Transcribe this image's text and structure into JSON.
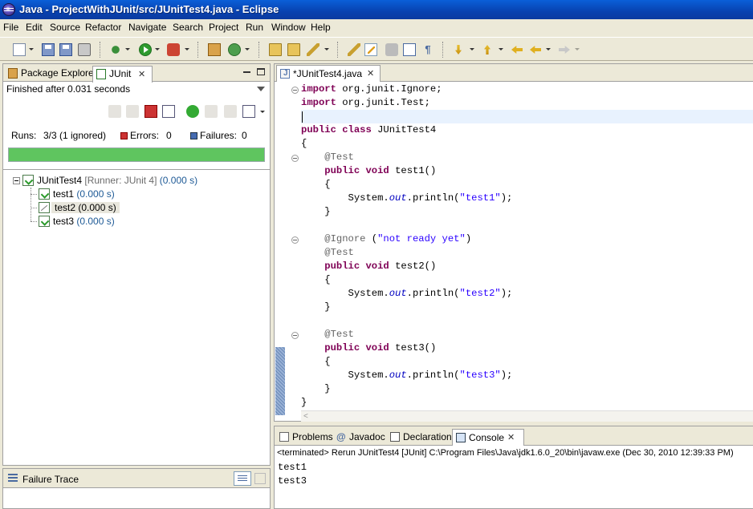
{
  "window": {
    "title": "Java - ProjectWithJUnit/src/JUnitTest4.java - Eclipse"
  },
  "menu": [
    "File",
    "Edit",
    "Source",
    "Refactor",
    "Navigate",
    "Search",
    "Project",
    "Run",
    "Window",
    "Help"
  ],
  "left_view": {
    "tabs": [
      "Package Explorer",
      "JUnit"
    ],
    "status": "Finished after 0.031 seconds",
    "runs_label": "Runs:",
    "runs_value": "3/3 (1 ignored)",
    "errors_label": "Errors:",
    "errors_value": "0",
    "failures_label": "Failures:",
    "failures_value": "0",
    "progress": 1.0,
    "progress_color": "#5fc55f",
    "tree": {
      "root": {
        "name": "JUnitTest4",
        "runner": "[Runner: JUnit 4]",
        "time": "(0.000 s)"
      },
      "tests": [
        {
          "name": "test1",
          "time": "(0.000 s)",
          "status": "passed"
        },
        {
          "name": "test2",
          "time": "(0.000 s)",
          "status": "ignored"
        },
        {
          "name": "test3",
          "time": "(0.000 s)",
          "status": "passed"
        }
      ]
    },
    "failure_trace_title": "Failure Trace"
  },
  "editor": {
    "tab_label": "*JUnitTest4.java",
    "lines": [
      [
        {
          "t": "import",
          "c": "kw"
        },
        {
          "t": " org.junit.Ignore;"
        }
      ],
      [
        {
          "t": "import",
          "c": "kw"
        },
        {
          "t": " org.junit.Test;"
        }
      ],
      [],
      [
        {
          "t": "public",
          "c": "kw"
        },
        {
          "t": " "
        },
        {
          "t": "class",
          "c": "kw"
        },
        {
          "t": " JUnitTest4"
        }
      ],
      [
        {
          "t": "{"
        }
      ],
      [
        {
          "t": "    "
        },
        {
          "t": "@Test",
          "c": "ann"
        }
      ],
      [
        {
          "t": "    "
        },
        {
          "t": "public",
          "c": "kw"
        },
        {
          "t": " "
        },
        {
          "t": "void",
          "c": "kw"
        },
        {
          "t": " test1()"
        }
      ],
      [
        {
          "t": "    {"
        }
      ],
      [
        {
          "t": "        System."
        },
        {
          "t": "out",
          "c": "it"
        },
        {
          "t": ".println("
        },
        {
          "t": "\"test1\"",
          "c": "str"
        },
        {
          "t": ");"
        }
      ],
      [
        {
          "t": "    }"
        }
      ],
      [],
      [
        {
          "t": "    "
        },
        {
          "t": "@Ignore",
          "c": "ann"
        },
        {
          "t": " ("
        },
        {
          "t": "\"not ready yet\"",
          "c": "str"
        },
        {
          "t": ")"
        }
      ],
      [
        {
          "t": "    "
        },
        {
          "t": "@Test",
          "c": "ann"
        }
      ],
      [
        {
          "t": "    "
        },
        {
          "t": "public",
          "c": "kw"
        },
        {
          "t": " "
        },
        {
          "t": "void",
          "c": "kw"
        },
        {
          "t": " test2()"
        }
      ],
      [
        {
          "t": "    {"
        }
      ],
      [
        {
          "t": "        System."
        },
        {
          "t": "out",
          "c": "it"
        },
        {
          "t": ".println("
        },
        {
          "t": "\"test2\"",
          "c": "str"
        },
        {
          "t": ");"
        }
      ],
      [
        {
          "t": "    }"
        }
      ],
      [],
      [
        {
          "t": "    "
        },
        {
          "t": "@Test",
          "c": "ann"
        }
      ],
      [
        {
          "t": "    "
        },
        {
          "t": "public",
          "c": "kw"
        },
        {
          "t": " "
        },
        {
          "t": "void",
          "c": "kw"
        },
        {
          "t": " test3()"
        }
      ],
      [
        {
          "t": "    {"
        }
      ],
      [
        {
          "t": "        System."
        },
        {
          "t": "out",
          "c": "it"
        },
        {
          "t": ".println("
        },
        {
          "t": "\"test3\"",
          "c": "str"
        },
        {
          "t": ");"
        }
      ],
      [
        {
          "t": "    }"
        }
      ],
      [
        {
          "t": "}"
        }
      ]
    ],
    "colors": {
      "keyword": "#7f0055",
      "string": "#2a00ff",
      "annotation": "#646464",
      "field": "#0000c0"
    }
  },
  "console": {
    "tabs": [
      "Problems",
      "Javadoc",
      "Declaration",
      "Console"
    ],
    "status": "<terminated> Rerun JUnitTest4 [JUnit] C:\\Program Files\\Java\\jdk1.6.0_20\\bin\\javaw.exe (Dec 30, 2010 12:39:33 PM)",
    "output": [
      "test1",
      "test3"
    ]
  }
}
